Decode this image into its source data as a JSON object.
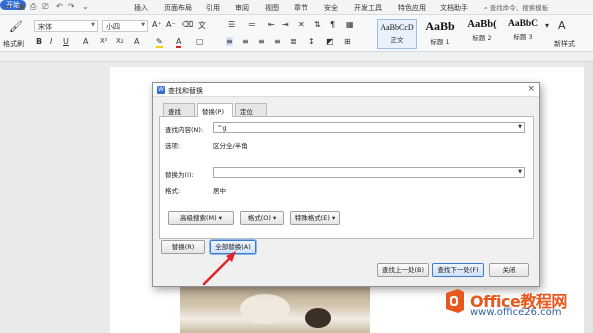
{
  "menubar": {
    "tabs": [
      "开始",
      "插入",
      "页面布局",
      "引用",
      "审阅",
      "视图",
      "章节",
      "安全",
      "开发工具",
      "特色应用",
      "文档助手"
    ],
    "search_placeholder": "查找命令、搜索模板"
  },
  "ribbon": {
    "format_painter": "格式刷",
    "font_name": "宋体",
    "font_size": "小四",
    "styles": [
      {
        "sample": "AaBbCcD",
        "label": "正文"
      },
      {
        "sample": "AaBb",
        "label": "标题 1"
      },
      {
        "sample": "AaBb(",
        "label": "标题 2"
      },
      {
        "sample": "AaBbC",
        "label": "标题 3"
      }
    ],
    "new_style": "新样式"
  },
  "dialog": {
    "title": "查找和替换",
    "tabs": [
      "查找(D)",
      "替换(P)",
      "定位(G)"
    ],
    "find_label": "查找内容(N):",
    "find_value": "^g",
    "options_label": "选项:",
    "options_value": "区分全/半角",
    "replace_label": "替换为(I):",
    "replace_value": "",
    "format_label": "格式:",
    "format_value": "居中",
    "advanced_search": "高级搜索(M) ▾",
    "format_btn": "格式(O) ▾",
    "special_btn": "特殊格式(E) ▾",
    "replace_btn": "替换(R)",
    "replace_all_btn": "全部替换(A)",
    "find_prev_btn": "查找上一处(B)",
    "find_next_btn": "查找下一处(F)",
    "close_btn": "关闭"
  },
  "watermark": {
    "brand": "Office教程网",
    "url": "www.office26.com"
  },
  "colors": {
    "accent": "#2f6ed8",
    "watermark_orange": "#e8571b",
    "arrow_red": "#e0242a"
  }
}
